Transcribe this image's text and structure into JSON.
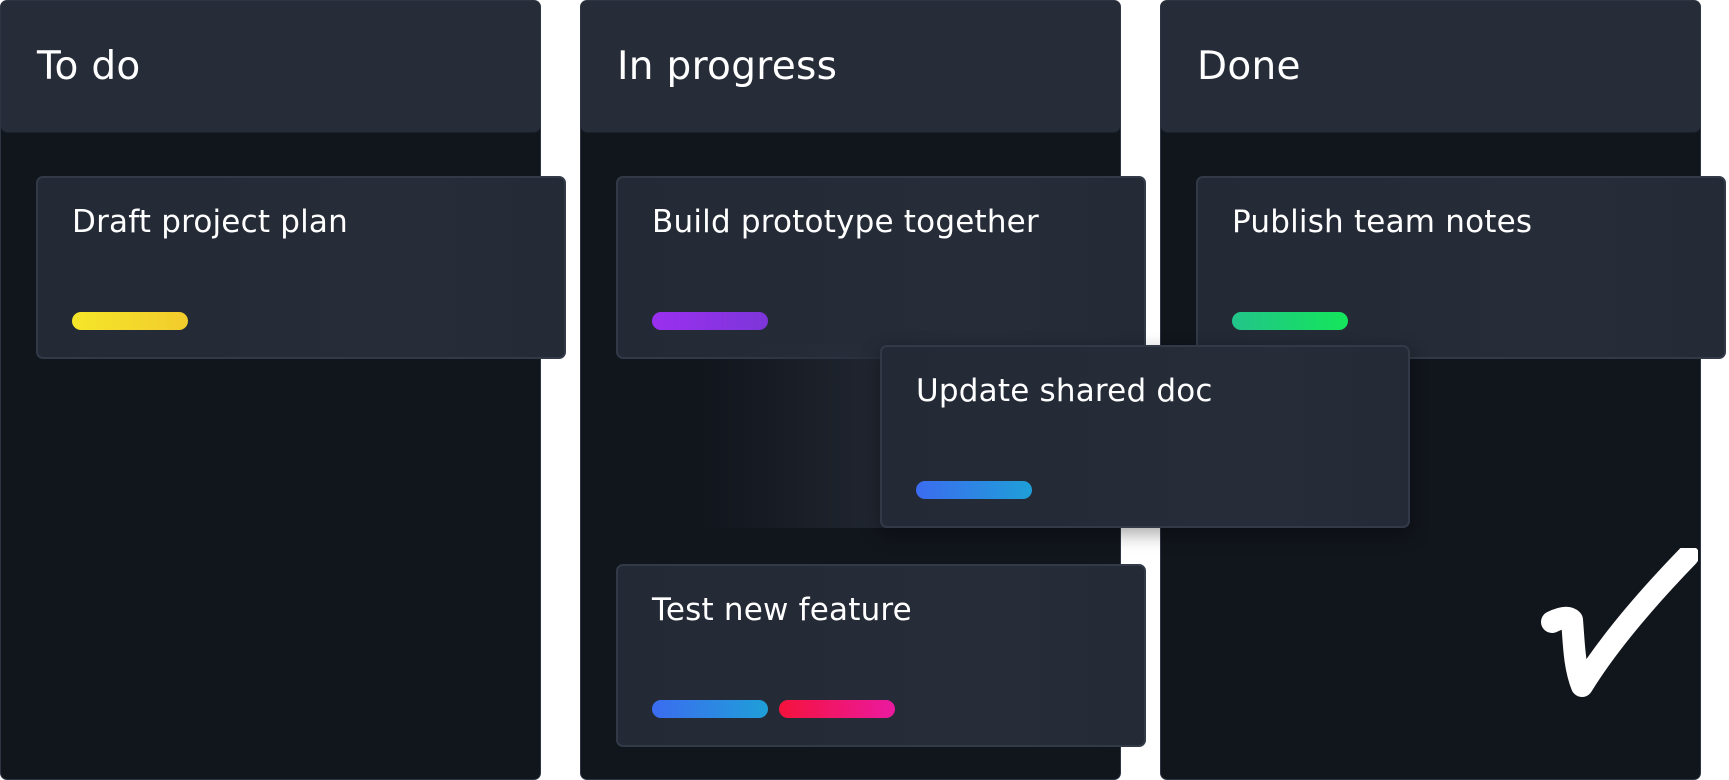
{
  "columns": [
    {
      "title": "To do"
    },
    {
      "title": "In progress"
    },
    {
      "title": "Done"
    }
  ],
  "cards": {
    "draft": {
      "title": "Draft project plan",
      "tags": [
        "yellow"
      ]
    },
    "build": {
      "title": "Build prototype together",
      "tags": [
        "purple"
      ]
    },
    "test": {
      "title": "Test new feature",
      "tags": [
        "blue",
        "pink"
      ]
    },
    "publish": {
      "title": "Publish team notes",
      "tags": [
        "green"
      ]
    },
    "update": {
      "title": "Update shared doc",
      "tags": [
        "blue"
      ],
      "state": "dragging"
    }
  },
  "colors": {
    "background": "#11151c",
    "column_header": "#262c38",
    "card": "#262c38",
    "tag_yellow": "#f5e62a",
    "tag_purple": "#9a2ff0",
    "tag_blue": "#3b6cf0",
    "tag_green": "#22c48a",
    "tag_pink": "#f5123c"
  },
  "icons": {
    "done_mark": "checkmark-icon"
  }
}
